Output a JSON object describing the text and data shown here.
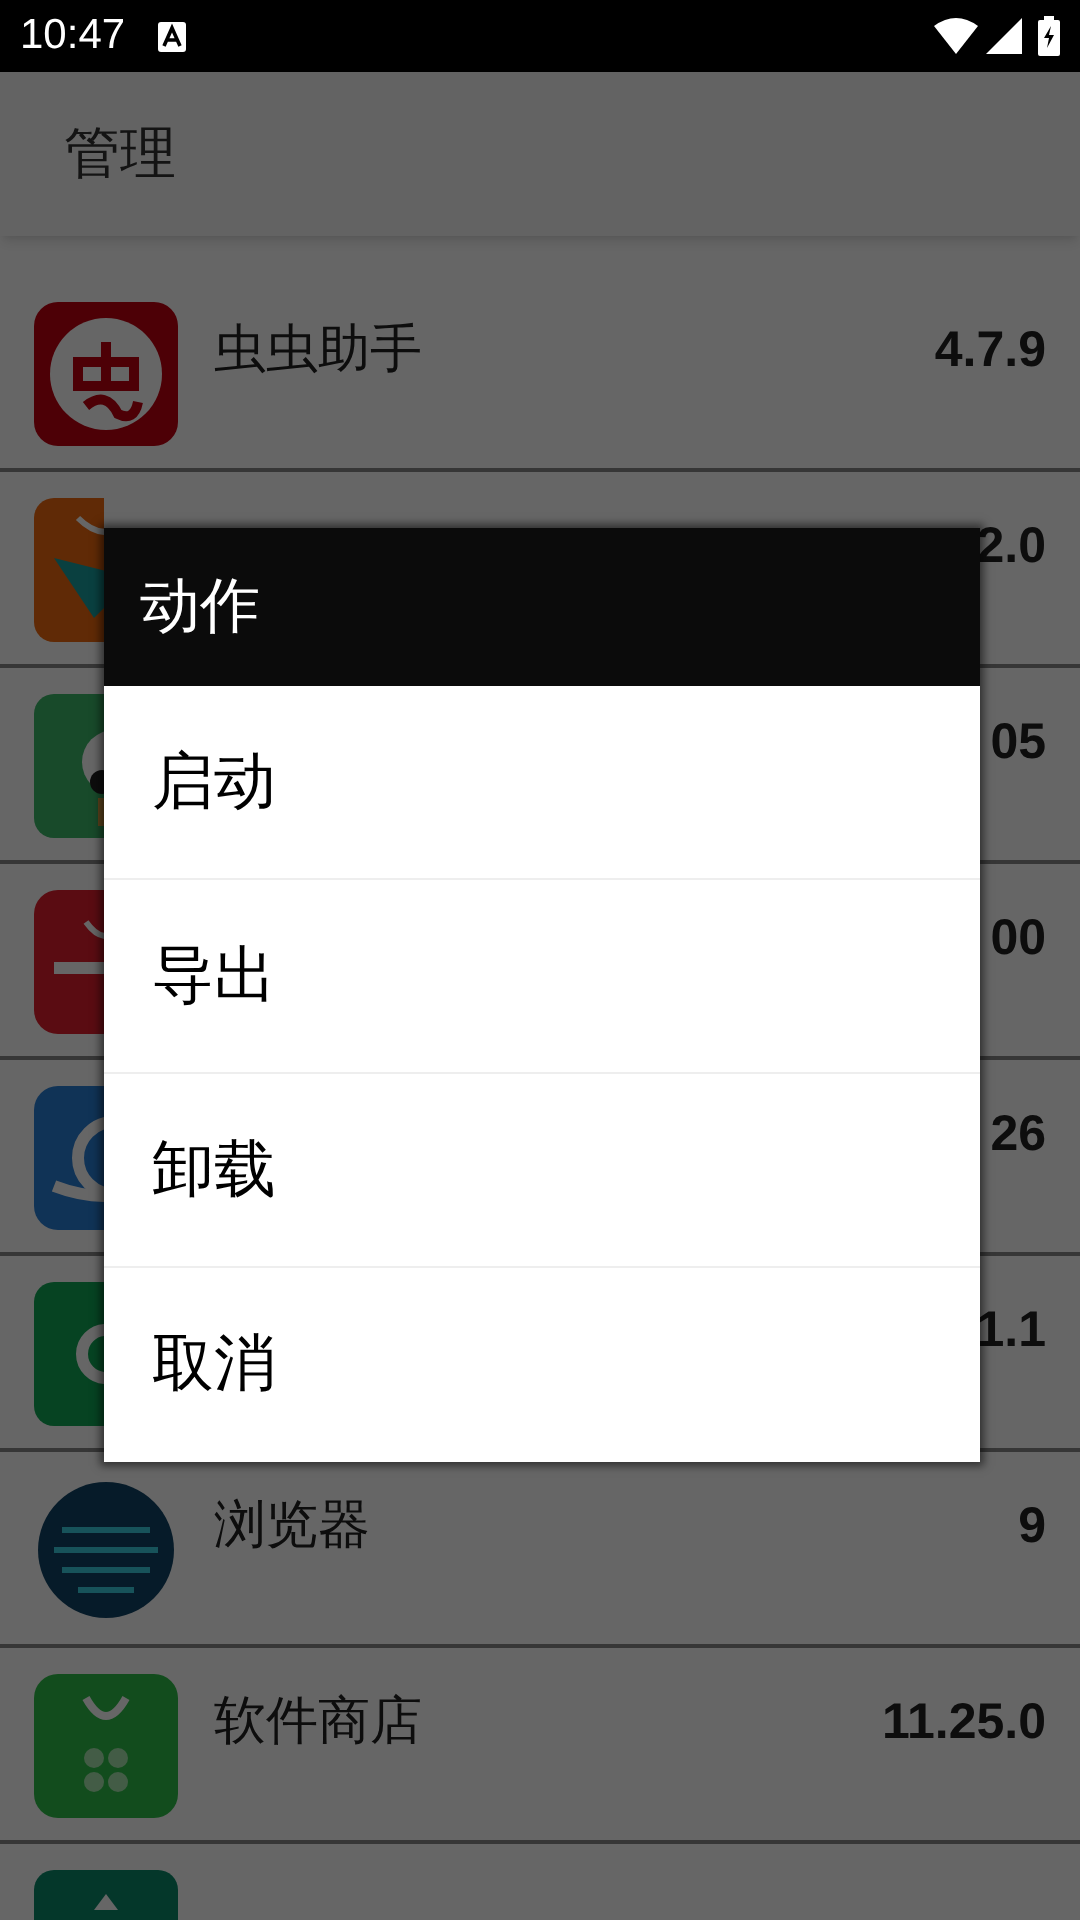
{
  "status_bar": {
    "time": "10:47"
  },
  "app_bar": {
    "title": "管理"
  },
  "apps": [
    {
      "name": "虫虫助手",
      "version": "4.7.9"
    },
    {
      "version": "2.0"
    },
    {
      "version": "05"
    },
    {
      "version": "00"
    },
    {
      "version": "26"
    },
    {
      "version": "1.1"
    },
    {
      "name": "浏览器",
      "version": "9"
    },
    {
      "name": "软件商店",
      "version": "11.25.0"
    }
  ],
  "dialog": {
    "title": "动作",
    "items": [
      "启动",
      "导出",
      "卸载",
      "取消"
    ]
  }
}
